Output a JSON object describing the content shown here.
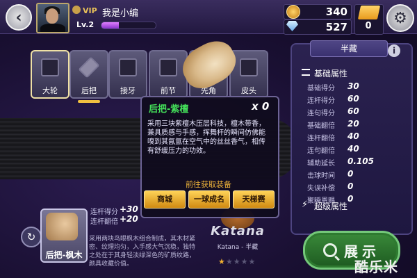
{
  "player": {
    "vip_label": "VIP",
    "name": "我是小编",
    "level": "Lv.2",
    "xp_fraction": 0.32
  },
  "currency": {
    "coins": "340",
    "gems": "527",
    "tickets": "0"
  },
  "tabs": [
    {
      "label": "大轮"
    },
    {
      "label": "后把"
    },
    {
      "label": "接牙"
    },
    {
      "label": "前节"
    },
    {
      "label": "先角"
    },
    {
      "label": "皮头"
    }
  ],
  "current_item": {
    "name": "后把-枫木",
    "stats": [
      {
        "label": "连杆得分",
        "value": "+30"
      },
      {
        "label": "连杆翻倍",
        "value": "+20"
      }
    ],
    "description": "采用两块鸟眼枫木组合制成，其木材紧密、纹理均匀，入手感大气沉稳，独特之处在于其身轻淡绿深色的矿质纹路，颜具收藏价值。"
  },
  "brand": {
    "logo_text": "Katana",
    "subtitle": "Katana - 半藏",
    "rating": 1,
    "rating_max": 5
  },
  "panel": {
    "tab_label": "半藏",
    "basic_title": "基础属性",
    "attributes": [
      {
        "name": "基础得分",
        "value": "30"
      },
      {
        "name": "连杆得分",
        "value": "60"
      },
      {
        "name": "连句得分",
        "value": "60"
      },
      {
        "name": "基础翻倍",
        "value": "20"
      },
      {
        "name": "连杆翻倍",
        "value": "40"
      },
      {
        "name": "连句翻倍",
        "value": "40"
      },
      {
        "name": "辅助延长",
        "value": "0.105"
      },
      {
        "name": "击球时间",
        "value": "0"
      },
      {
        "name": "失误补偿",
        "value": "0"
      },
      {
        "name": "聚瞬恩赐",
        "value": "0"
      }
    ],
    "super_title": "超级属性"
  },
  "show_button": {
    "label": "展示"
  },
  "popup": {
    "title": "后把-紫檀",
    "count": "x 0",
    "description": "采用三块紫檀木压层科技，檀木带香，兼具质感与手感，挥舞杆的瞬间仿佛能嗅到其氤氲在空气中的丝丝香气，相传有舒缓压力的功效。",
    "link_text": "前往获取装备",
    "buttons": [
      {
        "label": "商城"
      },
      {
        "label": "一球成名"
      },
      {
        "label": "天梯赛"
      }
    ]
  },
  "watermark": "酷乐米",
  "colors": {
    "popup_title": "#44e05a",
    "accent_gold": "#f0b53a",
    "show_button": "#2e7a30"
  }
}
